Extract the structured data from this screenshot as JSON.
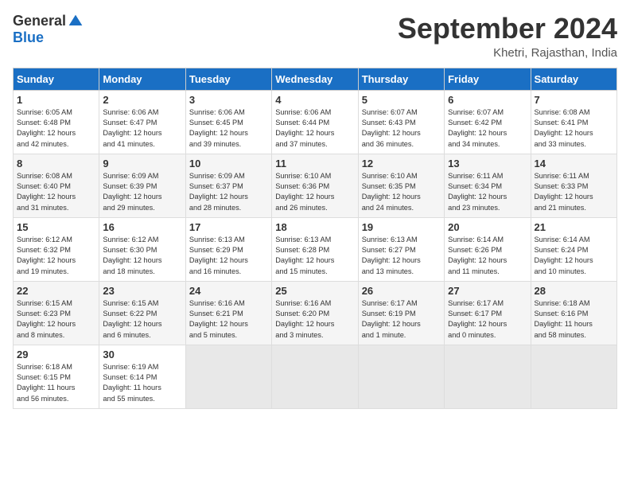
{
  "logo": {
    "general": "General",
    "blue": "Blue"
  },
  "title": "September 2024",
  "location": "Khetri, Rajasthan, India",
  "headers": [
    "Sunday",
    "Monday",
    "Tuesday",
    "Wednesday",
    "Thursday",
    "Friday",
    "Saturday"
  ],
  "weeks": [
    [
      {
        "day": "1",
        "rise": "6:05 AM",
        "set": "6:48 PM",
        "hours": "12",
        "min": "42"
      },
      {
        "day": "2",
        "rise": "6:06 AM",
        "set": "6:47 PM",
        "hours": "12",
        "min": "41"
      },
      {
        "day": "3",
        "rise": "6:06 AM",
        "set": "6:45 PM",
        "hours": "12",
        "min": "39"
      },
      {
        "day": "4",
        "rise": "6:06 AM",
        "set": "6:44 PM",
        "hours": "12",
        "min": "37"
      },
      {
        "day": "5",
        "rise": "6:07 AM",
        "set": "6:43 PM",
        "hours": "12",
        "min": "36"
      },
      {
        "day": "6",
        "rise": "6:07 AM",
        "set": "6:42 PM",
        "hours": "12",
        "min": "34"
      },
      {
        "day": "7",
        "rise": "6:08 AM",
        "set": "6:41 PM",
        "hours": "12",
        "min": "33"
      }
    ],
    [
      {
        "day": "8",
        "rise": "6:08 AM",
        "set": "6:40 PM",
        "hours": "12",
        "min": "31"
      },
      {
        "day": "9",
        "rise": "6:09 AM",
        "set": "6:39 PM",
        "hours": "12",
        "min": "29"
      },
      {
        "day": "10",
        "rise": "6:09 AM",
        "set": "6:37 PM",
        "hours": "12",
        "min": "28"
      },
      {
        "day": "11",
        "rise": "6:10 AM",
        "set": "6:36 PM",
        "hours": "12",
        "min": "26"
      },
      {
        "day": "12",
        "rise": "6:10 AM",
        "set": "6:35 PM",
        "hours": "12",
        "min": "24"
      },
      {
        "day": "13",
        "rise": "6:11 AM",
        "set": "6:34 PM",
        "hours": "12",
        "min": "23"
      },
      {
        "day": "14",
        "rise": "6:11 AM",
        "set": "6:33 PM",
        "hours": "12",
        "min": "21"
      }
    ],
    [
      {
        "day": "15",
        "rise": "6:12 AM",
        "set": "6:32 PM",
        "hours": "12",
        "min": "19"
      },
      {
        "day": "16",
        "rise": "6:12 AM",
        "set": "6:30 PM",
        "hours": "12",
        "min": "18"
      },
      {
        "day": "17",
        "rise": "6:13 AM",
        "set": "6:29 PM",
        "hours": "12",
        "min": "16"
      },
      {
        "day": "18",
        "rise": "6:13 AM",
        "set": "6:28 PM",
        "hours": "12",
        "min": "15"
      },
      {
        "day": "19",
        "rise": "6:13 AM",
        "set": "6:27 PM",
        "hours": "12",
        "min": "13"
      },
      {
        "day": "20",
        "rise": "6:14 AM",
        "set": "6:26 PM",
        "hours": "12",
        "min": "11"
      },
      {
        "day": "21",
        "rise": "6:14 AM",
        "set": "6:24 PM",
        "hours": "12",
        "min": "10"
      }
    ],
    [
      {
        "day": "22",
        "rise": "6:15 AM",
        "set": "6:23 PM",
        "hours": "12",
        "min": "8"
      },
      {
        "day": "23",
        "rise": "6:15 AM",
        "set": "6:22 PM",
        "hours": "12",
        "min": "6"
      },
      {
        "day": "24",
        "rise": "6:16 AM",
        "set": "6:21 PM",
        "hours": "12",
        "min": "5"
      },
      {
        "day": "25",
        "rise": "6:16 AM",
        "set": "6:20 PM",
        "hours": "12",
        "min": "3"
      },
      {
        "day": "26",
        "rise": "6:17 AM",
        "set": "6:19 PM",
        "hours": "12",
        "min": "1"
      },
      {
        "day": "27",
        "rise": "6:17 AM",
        "set": "6:17 PM",
        "hours": "12",
        "min": "0"
      },
      {
        "day": "28",
        "rise": "6:18 AM",
        "set": "6:16 PM",
        "hours": "11",
        "min": "58"
      }
    ],
    [
      {
        "day": "29",
        "rise": "6:18 AM",
        "set": "6:15 PM",
        "hours": "11",
        "min": "56"
      },
      {
        "day": "30",
        "rise": "6:19 AM",
        "set": "6:14 PM",
        "hours": "11",
        "min": "55"
      },
      null,
      null,
      null,
      null,
      null
    ]
  ]
}
